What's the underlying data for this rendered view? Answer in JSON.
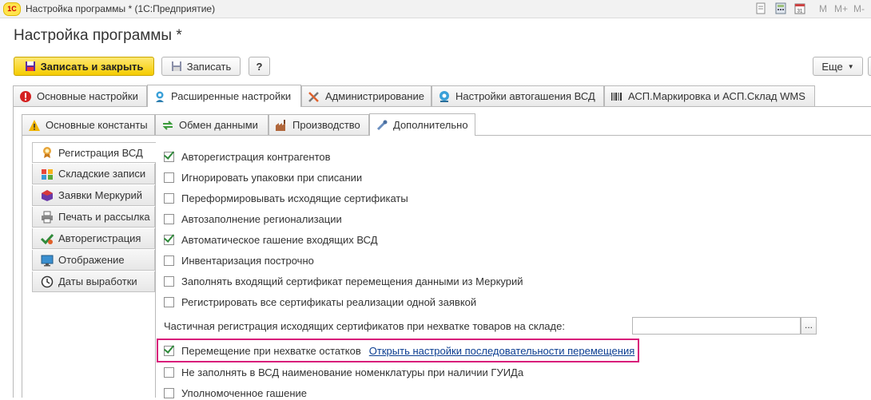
{
  "window": {
    "title": "Настройка программы * (1С:Предприятие)",
    "logo": "1С",
    "memory_buttons": [
      "M",
      "M+",
      "M-"
    ]
  },
  "page_title": "Настройка программы *",
  "toolbar": {
    "save_close": "Записать и закрыть",
    "save": "Записать",
    "help": "?",
    "more": "Еще"
  },
  "main_tabs": [
    {
      "label": "Основные настройки",
      "icon": "warning-icon"
    },
    {
      "label": "Расширенные настройки",
      "icon": "settings-user-icon",
      "active": true
    },
    {
      "label": "Администрирование",
      "icon": "tools-icon"
    },
    {
      "label": "Настройки автогашения ВСД",
      "icon": "auto-settings-icon"
    },
    {
      "label": "АСП.Маркировка и АСП.Склад WMS",
      "icon": "barcode-icon"
    }
  ],
  "sub_tabs": [
    {
      "label": "Основные константы",
      "icon": "warning-icon"
    },
    {
      "label": "Обмен данными",
      "icon": "exchange-icon"
    },
    {
      "label": "Производство",
      "icon": "factory-icon"
    },
    {
      "label": "Дополнительно",
      "icon": "tool-icon",
      "active": true
    }
  ],
  "sidebar": {
    "items": [
      {
        "label": "Регистрация ВСД",
        "icon": "certificate-icon",
        "active": true
      },
      {
        "label": "Складские записи",
        "icon": "warehouse-icon"
      },
      {
        "label": "Заявки Меркурий",
        "icon": "mercury-icon"
      },
      {
        "label": "Печать и рассылка",
        "icon": "printer-icon"
      },
      {
        "label": "Авторегистрация",
        "icon": "auto-check-icon"
      },
      {
        "label": "Отображение",
        "icon": "monitor-icon"
      },
      {
        "label": "Даты выработки",
        "icon": "clock-icon"
      }
    ]
  },
  "settings": {
    "items": [
      {
        "label": "Авторегистрация контрагентов",
        "checked": true
      },
      {
        "label": "Игнорировать упаковки при списании",
        "checked": false
      },
      {
        "label": "Переформировывать исходящие сертификаты",
        "checked": false
      },
      {
        "label": "Автозаполнение регионализации",
        "checked": false
      },
      {
        "label": "Автоматическое гашение входящих ВСД",
        "checked": true
      },
      {
        "label": "Инвентаризация построчно",
        "checked": false
      },
      {
        "label": "Заполнять входящий сертификат перемещения данными из Меркурий",
        "checked": false
      },
      {
        "label": "Регистрировать все сертификаты реализации одной заявкой",
        "checked": false
      }
    ],
    "partial_label": "Частичная регистрация исходящих сертификатов при нехватке товаров на складе:",
    "partial_value": "",
    "partial_button": "...",
    "highlight_item": {
      "label": "Перемещение при нехватке остатков",
      "checked": true
    },
    "highlight_link": "Открыть настройки последовательности перемещения",
    "items_after": [
      {
        "label": "Не заполнять в ВСД наименование номенклатуры при наличии ГУИДа",
        "checked": false
      },
      {
        "label": "Уполномоченное гашение",
        "checked": false
      }
    ]
  },
  "colors": {
    "accent_yellow": "#f5cc00",
    "highlight_border": "#d81b7a",
    "check_green": "#2f8a3a",
    "link_blue": "#0b3d91"
  }
}
